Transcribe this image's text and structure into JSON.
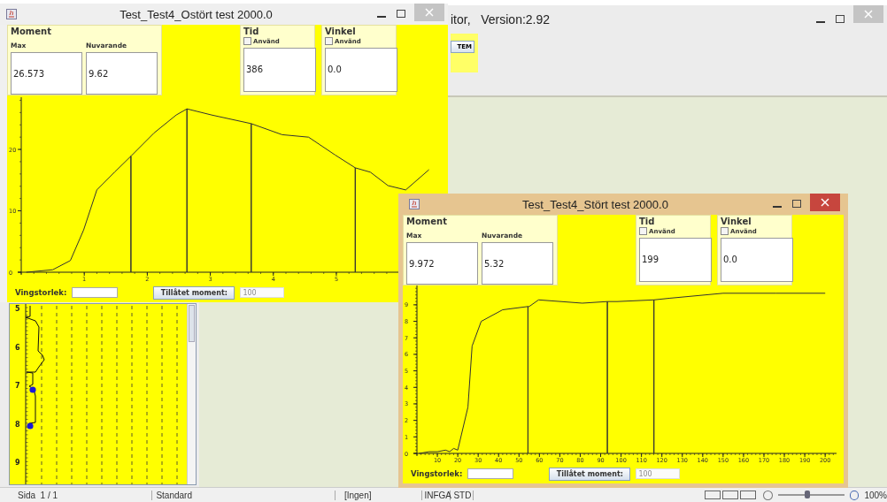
{
  "background_window": {
    "title": "itor,   Version:2.92",
    "active": false,
    "toolbar_button": "TEM",
    "profile_plot": {
      "tick_labels": [
        "5",
        "6",
        "7",
        "8",
        "9"
      ]
    },
    "status_bar": [
      {
        "text": "Sida  1 / 1"
      },
      {
        "text": "Standard"
      },
      {
        "text": "[Ingen]"
      },
      {
        "text": "INFGA"
      },
      {
        "text": "STD"
      }
    ],
    "zoom_slider": {
      "level": 0.45
    },
    "zoom_text": "100%"
  },
  "windows": [
    {
      "title": "Test_Test4_Ostört test 2000.0",
      "active": false,
      "moment": {
        "heading": "Moment",
        "max_label": "Max",
        "max": "26.573",
        "current_label": "Nuvarande",
        "current": "9.62"
      },
      "panels": [
        {
          "heading": "Tid",
          "checkbox_label": "Använd",
          "checked": false,
          "value": "386"
        },
        {
          "heading": "Vinkel",
          "checkbox_label": "Använd",
          "checked": false,
          "value": "0.0"
        }
      ],
      "chart_data": {
        "type": "line",
        "xlim": [
          0,
          6.63
        ],
        "ylim": [
          0,
          28.5
        ],
        "xticks": [
          1,
          2,
          3,
          4,
          5
        ],
        "yticks": [
          0,
          10,
          20
        ],
        "x": [
          0.08,
          0.5,
          0.78,
          0.99,
          1.2,
          1.48,
          1.74,
          1.74,
          1.74,
          2.11,
          2.46,
          2.63,
          2.63,
          2.63,
          3.02,
          3.65,
          3.65,
          3.65,
          4.14,
          4.56,
          4.98,
          5.3,
          5.3,
          5.3,
          5.54,
          5.82,
          6.1,
          6.47
        ],
        "series": [
          {
            "color": "#333333",
            "values": [
              0,
              0.4,
              1.9,
              6.9,
              13.4,
              16.3,
              18.9,
              0,
              18.9,
              22.7,
              25.6,
              26.6,
              0,
              26.6,
              25.6,
              24.2,
              0,
              24.2,
              22.4,
              22,
              19.1,
              17,
              0,
              17,
              16.3,
              14.1,
              13.4,
              16.7
            ]
          }
        ]
      },
      "wing_label": "Vingstorlek:",
      "allowed_button": "Tillåtet moment:",
      "allowed_field": {
        "value": "100",
        "disabled": true
      }
    },
    {
      "title": "Test_Test4_Stört test 2000.0",
      "active": true,
      "moment": {
        "heading": "Moment",
        "max_label": "Max",
        "max": "9.972",
        "current_label": "Nuvarande",
        "current": "5.32"
      },
      "panels": [
        {
          "heading": "Tid",
          "checkbox_label": "Använd",
          "checked": false,
          "value": "199"
        },
        {
          "heading": "Vinkel",
          "checkbox_label": "Använd",
          "checked": false,
          "value": "0.0"
        }
      ],
      "chart_data": {
        "type": "line",
        "xlim": [
          0,
          204.7
        ],
        "ylim": [
          0,
          10.6
        ],
        "xticks": [
          10,
          20,
          30,
          40,
          50,
          60,
          70,
          80,
          90,
          100,
          110,
          120,
          130,
          140,
          150,
          160,
          170,
          180,
          190,
          200
        ],
        "yticks": [
          0,
          1,
          2,
          3,
          4,
          5,
          6,
          7,
          8,
          9
        ],
        "x": [
          1,
          6,
          10,
          14,
          16,
          18,
          20,
          25,
          27,
          31.5,
          42,
          54.4,
          54.4,
          54.4,
          55,
          59.6,
          81,
          93.3,
          93.3,
          93.3,
          98,
          116.1,
          116.1,
          116.1,
          124,
          150,
          176,
          200
        ],
        "series": [
          {
            "color": "#333333",
            "values": [
              0,
              0.1,
              0.1,
              0.2,
              0.1,
              0.3,
              0.2,
              2.8,
              6.5,
              8,
              8.7,
              8.9,
              0,
              8.9,
              8.9,
              9.3,
              9.1,
              9.2,
              0,
              9.2,
              9.2,
              9.3,
              0,
              9.3,
              9.4,
              9.7,
              9.7,
              9.7
            ]
          }
        ]
      },
      "wing_label": "Vingstorlek:",
      "allowed_button": "Tillåtet moment:",
      "allowed_field": {
        "value": "100",
        "disabled": true
      }
    }
  ]
}
